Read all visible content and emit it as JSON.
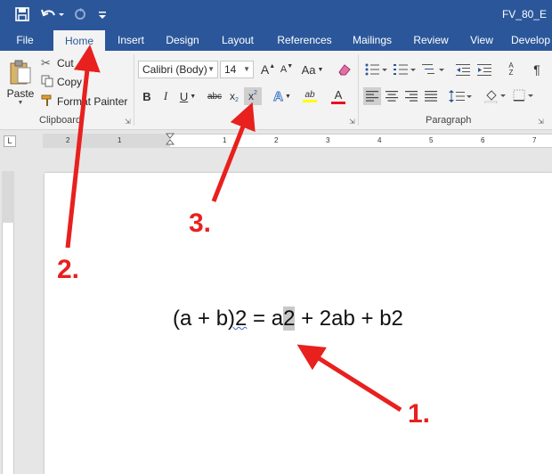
{
  "window": {
    "doc_title": "FV_80_E"
  },
  "quick_access": {
    "save_icon": "save-icon",
    "undo_icon": "undo-icon",
    "redo_icon": "redo-icon",
    "customize_icon": "customize-icon"
  },
  "tabs": [
    {
      "label": "File"
    },
    {
      "label": "Home"
    },
    {
      "label": "Insert"
    },
    {
      "label": "Design"
    },
    {
      "label": "Layout"
    },
    {
      "label": "References"
    },
    {
      "label": "Mailings"
    },
    {
      "label": "Review"
    },
    {
      "label": "View"
    },
    {
      "label": "Develop"
    }
  ],
  "active_tab": "Home",
  "clipboard": {
    "paste": "Paste",
    "cut": "Cut",
    "copy": "Copy",
    "format_painter": "Format Painter",
    "group_label": "Clipboard"
  },
  "font": {
    "family": "Calibri (Body)",
    "size": "14",
    "grow": "A",
    "shrink": "A",
    "change_case": "Aa",
    "bold": "B",
    "italic": "I",
    "underline": "U",
    "strikethrough": "abc",
    "subscript": "x",
    "subscript_mark": "2",
    "superscript": "x",
    "superscript_mark": "2",
    "text_effects": "A",
    "highlight": "ab",
    "font_color": "A"
  },
  "paragraph": {
    "group_label": "Paragraph",
    "sort": "A Z",
    "pilcrow": "¶"
  },
  "ruler": {
    "marks": [
      "2",
      "1",
      "1",
      "2",
      "3",
      "4",
      "5",
      "6",
      "7"
    ]
  },
  "document": {
    "eq_part1": "(a + b",
    "eq_part2": ")2",
    "eq_part3": " = a",
    "eq_selected": "2",
    "eq_part4": " + 2ab + b2"
  },
  "callouts": {
    "c1": "1.",
    "c2": "2.",
    "c3": "3."
  },
  "colors": {
    "brand": "#2b579a",
    "ribbon_bg": "#f3f3f3",
    "annotation": "#e8201e",
    "highlight": "#ffff00",
    "font_color": "#e81123"
  }
}
